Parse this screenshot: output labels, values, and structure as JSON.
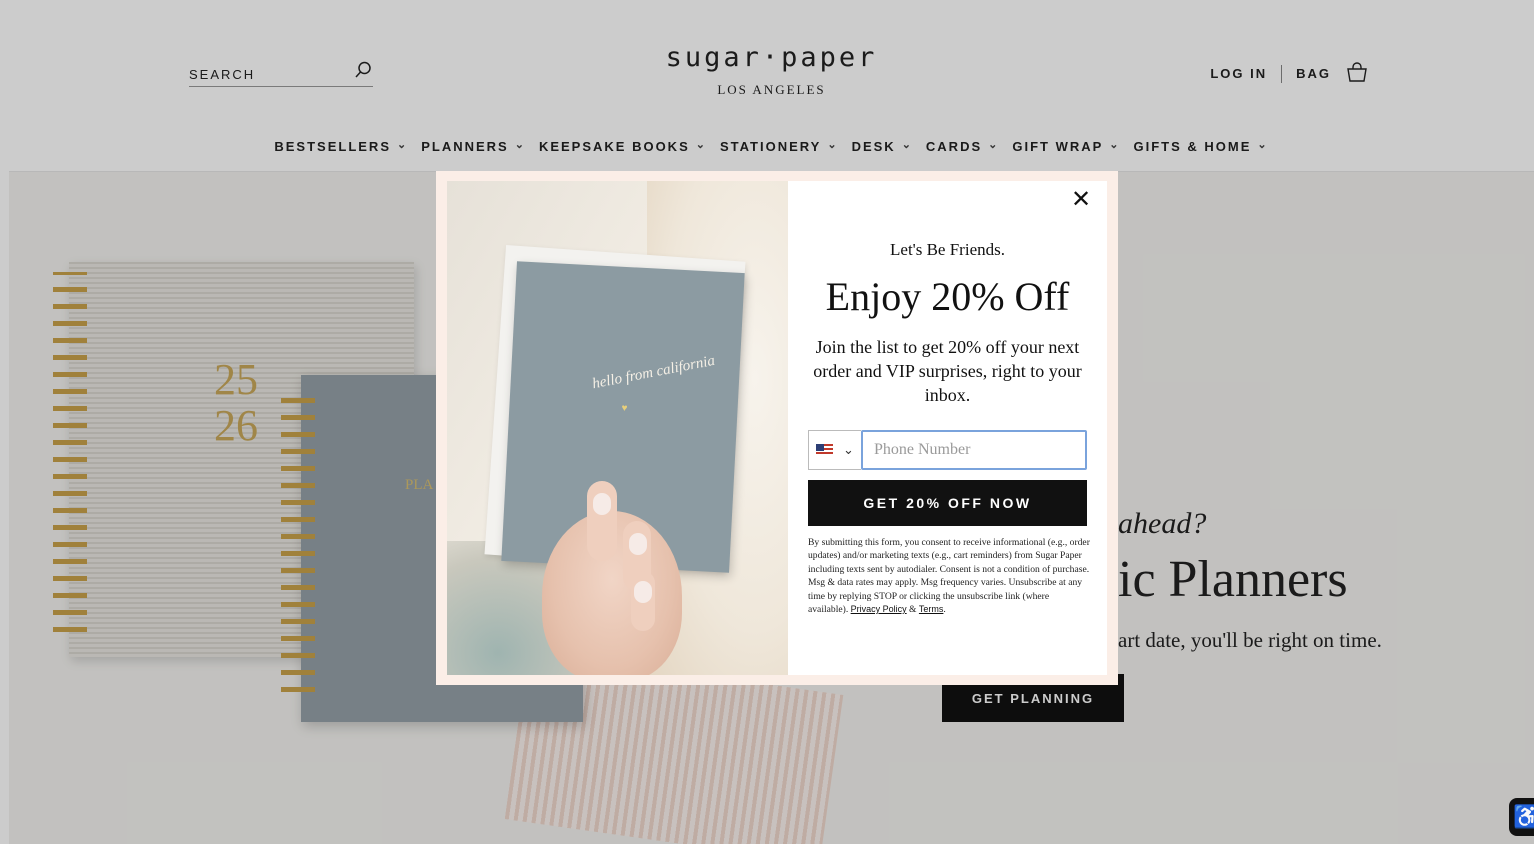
{
  "header": {
    "search_label": "SEARCH",
    "brand": "sugar·paper",
    "city": "LOS ANGELES",
    "login_label": "LOG IN",
    "bag_label": "BAG"
  },
  "nav": {
    "items": [
      {
        "label": "BESTSELLERS"
      },
      {
        "label": "PLANNERS"
      },
      {
        "label": "KEEPSAKE BOOKS"
      },
      {
        "label": "STATIONERY"
      },
      {
        "label": "DESK"
      },
      {
        "label": "CARDS"
      },
      {
        "label": "GIFT WRAP"
      },
      {
        "label": "GIFTS & HOME"
      }
    ]
  },
  "hero": {
    "planner_year_top": "25",
    "planner_year_bottom": "26",
    "planner2_text": "PLA",
    "question_partial": "ahead?",
    "heading_partial": "ic Planners",
    "subtext_partial": "art date, you'll be right on time.",
    "cta_label": "GET PLANNING"
  },
  "modal": {
    "card_text": "hello from california",
    "eyebrow": "Let's Be Friends.",
    "headline": "Enjoy 20% Off",
    "description": "Join the list to get 20% off your next order and VIP surprises, right to your inbox.",
    "country_flag": "us-flag-icon",
    "phone_placeholder": "Phone Number",
    "phone_value": "",
    "submit_label": "GET 20% OFF NOW",
    "legal_text": "By submitting this form, you consent to receive informational (e.g., order updates) and/or marketing texts (e.g., cart reminders) from Sugar Paper including texts sent by autodialer. Consent is not a condition of purchase. Msg & data rates may apply. Msg frequency varies. Unsubscribe at any time by replying STOP or clicking the unsubscribe link (where available).",
    "privacy_label": "Privacy Policy",
    "amp": "&",
    "terms_label": "Terms",
    "period": ".",
    "close_glyph": "✕"
  },
  "colors": {
    "overlay": "#000000",
    "modal_border": "#fbeee7",
    "button_bg": "#111111",
    "input_focus": "#7aa3dc"
  }
}
